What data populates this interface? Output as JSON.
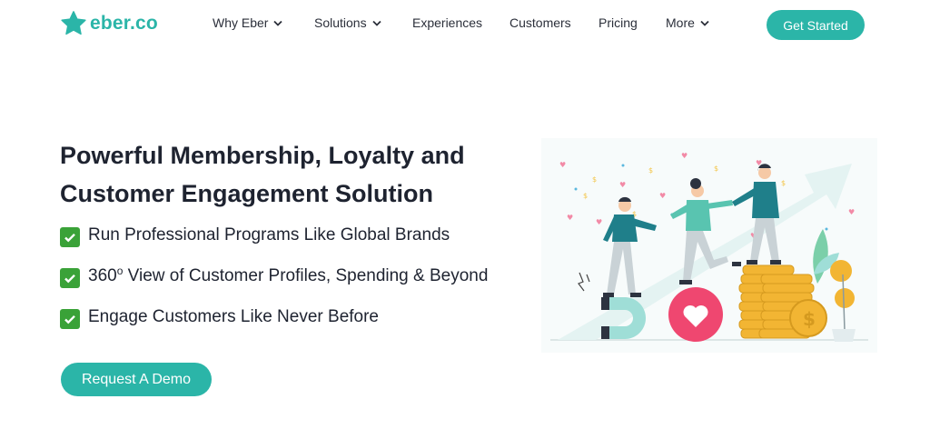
{
  "brand": {
    "name": "eber.co",
    "logo_icon": "star-icon",
    "accent_color": "#2bb5a8"
  },
  "nav": {
    "items": [
      {
        "label": "Why Eber",
        "has_dropdown": true
      },
      {
        "label": "Solutions",
        "has_dropdown": true
      },
      {
        "label": "Experiences",
        "has_dropdown": false
      },
      {
        "label": "Customers",
        "has_dropdown": false
      },
      {
        "label": "Pricing",
        "has_dropdown": false
      },
      {
        "label": "More",
        "has_dropdown": true
      }
    ],
    "cta_label": "Get Started"
  },
  "hero": {
    "title_line1": "Powerful Membership, Loyalty and",
    "title_line2": "Customer Engagement Solution",
    "features": [
      {
        "text": "Run Professional Programs Like Global Brands"
      },
      {
        "prefix": "360",
        "superscript": "o",
        "text": " View of Customer Profiles, Spending & Beyond"
      },
      {
        "text": "Engage Customers Like Never Before"
      }
    ],
    "check_icon": "check-mark-icon",
    "check_color": "#3aa238",
    "demo_button_label": "Request A Demo"
  }
}
